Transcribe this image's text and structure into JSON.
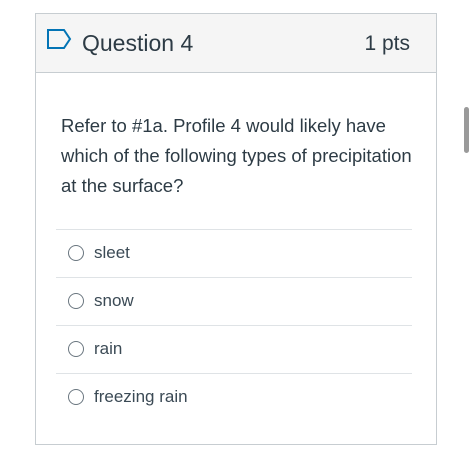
{
  "question": {
    "title": "Question 4",
    "points": "1 pts",
    "text": "Refer to #1a. Profile 4 would likely have which of the following types of precipitation at the surface?",
    "flag_icon": "flag-outline-icon"
  },
  "answers": [
    {
      "label": "sleet",
      "selected": false
    },
    {
      "label": "snow",
      "selected": false
    },
    {
      "label": "rain",
      "selected": false
    },
    {
      "label": "freezing rain",
      "selected": false
    }
  ],
  "colors": {
    "accent": "#0374b5",
    "text": "#2d3b45",
    "header_bg": "#f5f5f5",
    "border": "#c7cdd1"
  }
}
